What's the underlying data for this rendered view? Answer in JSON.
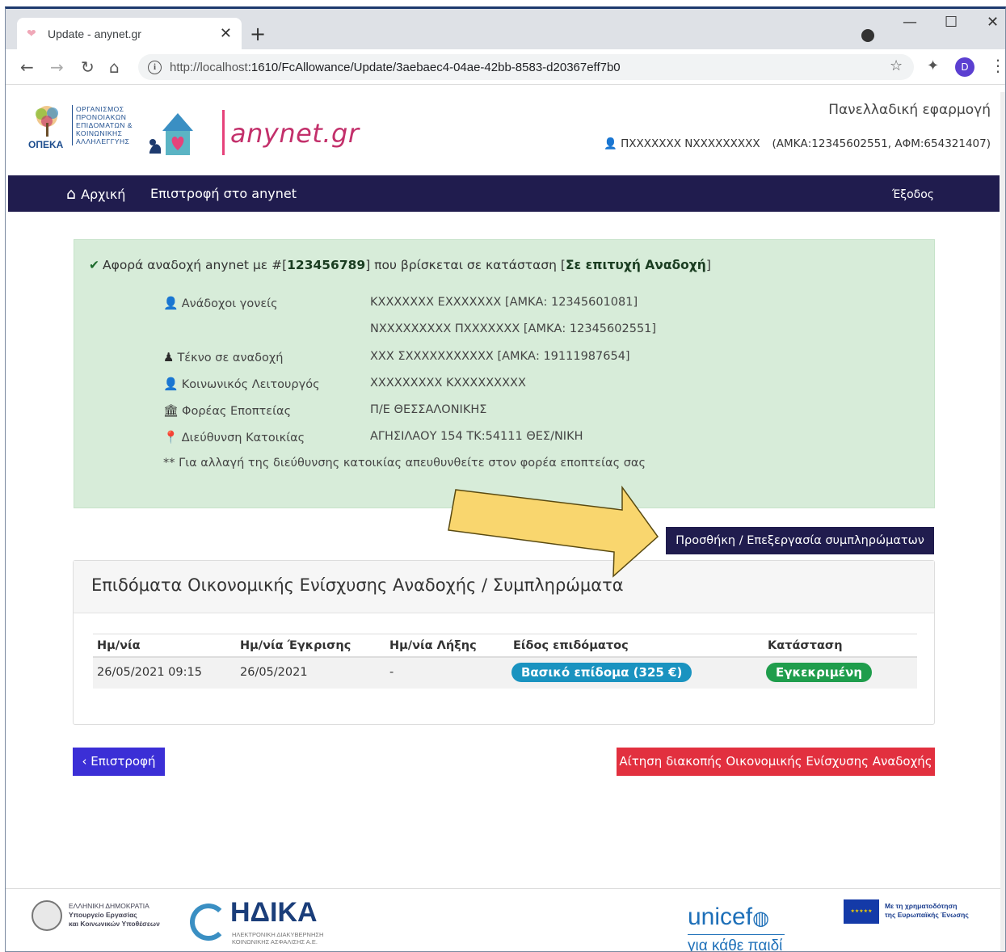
{
  "browser": {
    "tab_title": "Update - anynet.gr",
    "url_host": "http://localhost",
    "url_rest": ":1610/FcAllowance/Update/3aebaec4-04ae-42bb-8583-d20367eff7b0",
    "avatar_letter": "D"
  },
  "header": {
    "opeka_label": "ΟΠΕΚΑ",
    "opeka_org": [
      "ΟΡΓΑΝΙΣΜΟΣ",
      "ΠΡΟΝΟΙΑΚΩΝ",
      "ΕΠΙΔΟΜΑΤΩΝ &",
      "ΚΟΙΝΩΝΙΚΗΣ",
      "ΑΛΛΗΛΕΓΓΥΗΣ"
    ],
    "brand": "anynet.gr",
    "app_title": "Πανελλαδική εφαρμογή",
    "user_name": "ΠΧΧΧΧΧΧΧ ΝΧΧΧΧΧΧΧΧΧ",
    "user_ids": "(ΑΜΚΑ:12345602551, ΑΦΜ:654321407)"
  },
  "nav": {
    "home": "Αρχική",
    "back_to_anynet": "Επιστροφή στο anynet",
    "exit": "Έξοδος"
  },
  "alert": {
    "prefix": "Αφορά αναδοχή anynet με #[",
    "id": "123456789",
    "middle": "] που βρίσκεται σε κατάσταση [",
    "status": "Σε επιτυχή Αναδοχή",
    "suffix": "]",
    "rows": [
      {
        "label": "Ανάδοχοι γονείς",
        "value": "ΚΧΧΧΧΧΧΧ   ΕΧΧΧΧΧΧΧ   [ΑΜΚΑ: 12345601081]"
      },
      {
        "label": "",
        "value": "ΝΧΧΧΧΧΧΧΧΧ   ΠΧΧΧΧΧΧΧ   [ΑΜΚΑ: 12345602551]"
      },
      {
        "label": "Τέκνο σε αναδοχή",
        "value": "ΧΧΧ   ΣΧΧΧΧΧΧΧΧΧΧΧ   [ΑΜΚΑ: 19111987654]"
      },
      {
        "label": "Κοινωνικός Λειτουργός",
        "value": "ΧΧΧΧΧΧΧΧΧ ΚΧΧΧΧΧΧΧΧΧ"
      },
      {
        "label": "Φορέας Εποπτείας",
        "value": "Π/Ε ΘΕΣΣΑΛΟΝΙΚΗΣ"
      },
      {
        "label": "Διεύθυνση Κατοικίας",
        "value": "ΑΓΗΣΙΛΑΟΥ 154 ΤΚ:54111 ΘΕΣ/ΝΙΚΗ"
      }
    ],
    "note": "** Για αλλαγή της διεύθυνσης κατοικίας απευθυνθείτε στον φορέα εποπτείας σας"
  },
  "add_button": "Προσθήκη / Επεξεργασία συμπληρώματων",
  "panel": {
    "title": "Επιδόματα Οικονομικής Ενίσχυσης Αναδοχής / Συμπληρώματα",
    "columns": [
      "Ημ/νία",
      "Ημ/νία Έγκρισης",
      "Ημ/νία Λήξης",
      "Είδος επιδόματος",
      "Κατάσταση"
    ],
    "rows": [
      {
        "date": "26/05/2021 09:15",
        "approval": "26/05/2021",
        "end": "-",
        "type": "Βασικό επίδομα (325 €)",
        "status": "Εγκεκριμένη"
      }
    ]
  },
  "back_button": "Επιστροφή",
  "stop_button": "Αίτηση διακοπής Οικονομικής Ενίσχυσης Αναδοχής",
  "footer": {
    "gov_lines": [
      "ΕΛΛΗΝΙΚΗ ΔΗΜΟΚΡΑΤΙΑ",
      "Υπουργείο Εργασίας",
      "και Κοινωνικών Υποθέσεων"
    ],
    "idika": "ΗΔΙΚΑ",
    "idika_sub": [
      "ΗΛΕΚΤΡΟΝΙΚΗ ΔΙΑΚΥΒΕΡΝΗΣΗ",
      "ΚΟΙΝΩΝΙΚΗΣ ΑΣΦΑΛΙΣΗΣ Α.Ε."
    ],
    "unicef": "unicef",
    "unicef_sub": "για κάθε παιδί",
    "eu_lines": [
      "Με τη χρηματοδότηση",
      "της Ευρωπαϊκής Ένωσης"
    ]
  },
  "colors": {
    "navbar": "#201c4e",
    "alert_bg": "#d7ecd9",
    "brand": "#c3306b",
    "back_button": "#3b2fd6",
    "stop_button": "#e2303f",
    "badge_type": "#1a93c0",
    "badge_status": "#1f9d4c",
    "arrow_fill": "#f9d66e"
  }
}
